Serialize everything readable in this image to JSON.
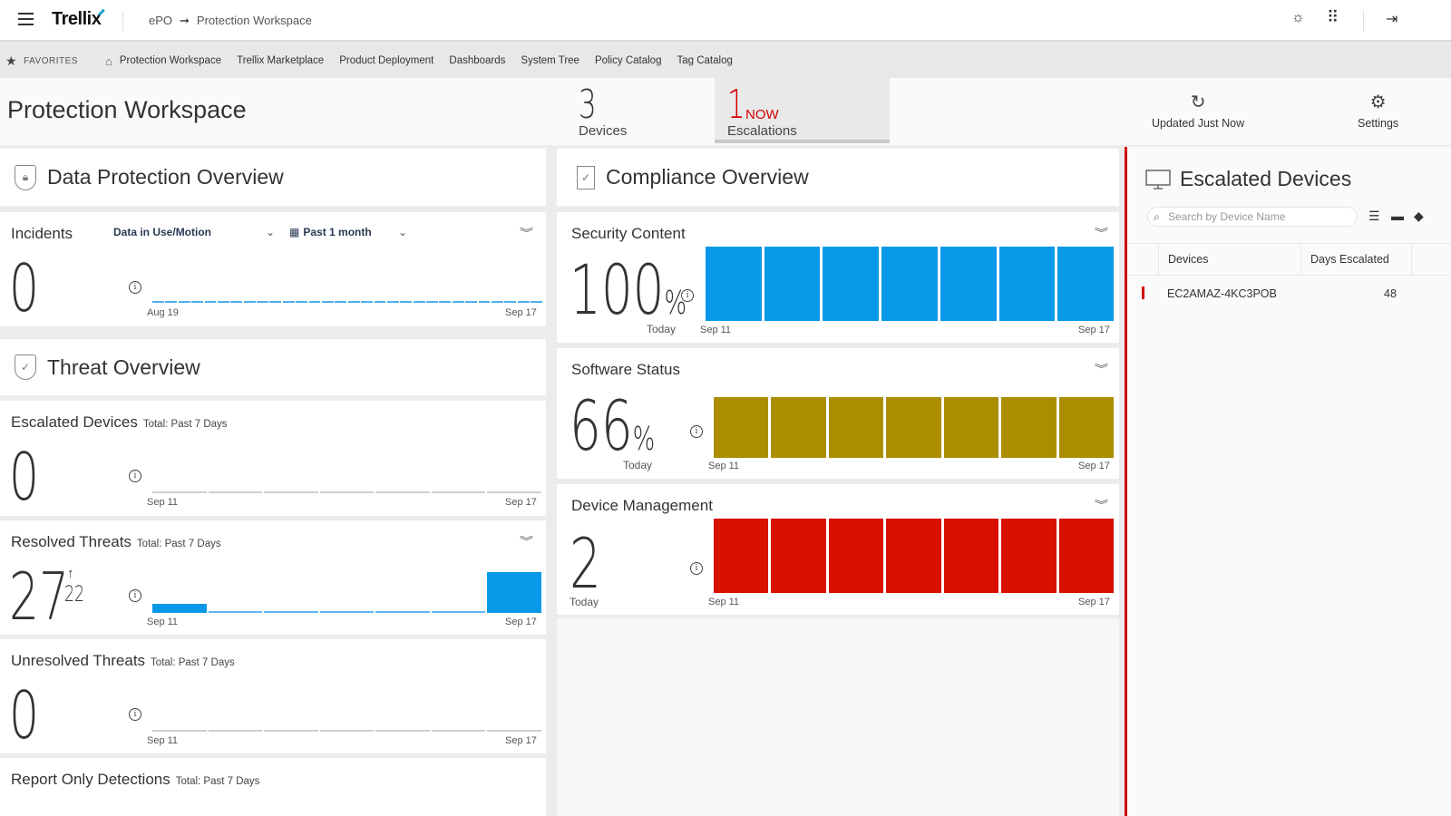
{
  "topbar": {
    "app_name": "Trellix",
    "breadcrumb": [
      "ePO",
      "Protection Workspace"
    ],
    "icons": [
      "menu-icon",
      "brightness-icon",
      "app-grid-icon",
      "logout-icon"
    ]
  },
  "favorites": {
    "label": "FAVORITES",
    "items": [
      "Protection Workspace",
      "Trellix Marketplace",
      "Product Deployment",
      "Dashboards",
      "System Tree",
      "Policy Catalog",
      "Tag Catalog"
    ]
  },
  "header": {
    "title": "Protection Workspace",
    "devices": {
      "value": "3",
      "label": "Devices"
    },
    "escalations": {
      "value": "1",
      "now": "NOW",
      "label": "Escalations"
    },
    "updated": "Updated Just Now",
    "settings": "Settings"
  },
  "data_protection": {
    "title": "Data Protection Overview",
    "incidents": {
      "title": "Incidents",
      "filter": "Data in Use/Motion",
      "period": "Past 1 month",
      "value": "0",
      "x_start": "Aug 19",
      "x_end": "Sep 17",
      "segments": 30
    }
  },
  "threat": {
    "title": "Threat Overview",
    "cards": [
      {
        "title": "Escalated Devices",
        "sub": "Total: Past 7 Days",
        "value": "0",
        "delta": "",
        "x_start": "Sep 11",
        "x_end": "Sep 17",
        "values": [
          0,
          0,
          0,
          0,
          0,
          0,
          0
        ],
        "expand": false
      },
      {
        "title": "Resolved Threats",
        "sub": "Total: Past 7 Days",
        "value": "27",
        "delta": "22",
        "x_start": "Sep 11",
        "x_end": "Sep 17",
        "values": [
          5,
          0,
          0,
          0,
          0,
          0,
          22
        ],
        "expand": true
      },
      {
        "title": "Unresolved Threats",
        "sub": "Total: Past 7 Days",
        "value": "0",
        "delta": "",
        "x_start": "Sep 11",
        "x_end": "Sep 17",
        "values": [
          0,
          0,
          0,
          0,
          0,
          0,
          0
        ],
        "expand": false
      },
      {
        "title": "Report Only Detections",
        "sub": "Total: Past 7 Days"
      }
    ]
  },
  "compliance": {
    "title": "Compliance Overview",
    "cards": [
      {
        "title": "Security Content",
        "value": "100",
        "unit": "%",
        "today": "Today",
        "x_start": "Sep 11",
        "x_end": "Sep 17",
        "bars": 7,
        "color": "#0799e8"
      },
      {
        "title": "Software Status",
        "value": "66",
        "unit": "%",
        "today": "Today",
        "x_start": "Sep 11",
        "x_end": "Sep 17",
        "bars": 7,
        "color": "#aa8e00"
      },
      {
        "title": "Device Management",
        "value": "2",
        "unit": "",
        "today": "Today",
        "x_start": "Sep 11",
        "x_end": "Sep 17",
        "bars": 7,
        "color": "#d90f00"
      }
    ]
  },
  "escalated_devices": {
    "title": "Escalated Devices",
    "search_placeholder": "Search by Device Name",
    "columns": [
      "Devices",
      "Days Escalated"
    ],
    "rows": [
      {
        "device": "EC2AMAZ-4KC3POB",
        "days": "48"
      }
    ]
  },
  "colors": {
    "accent_red": "#d40000",
    "blue": "#0799e8",
    "olive": "#aa8e00",
    "red": "#d90f00"
  }
}
